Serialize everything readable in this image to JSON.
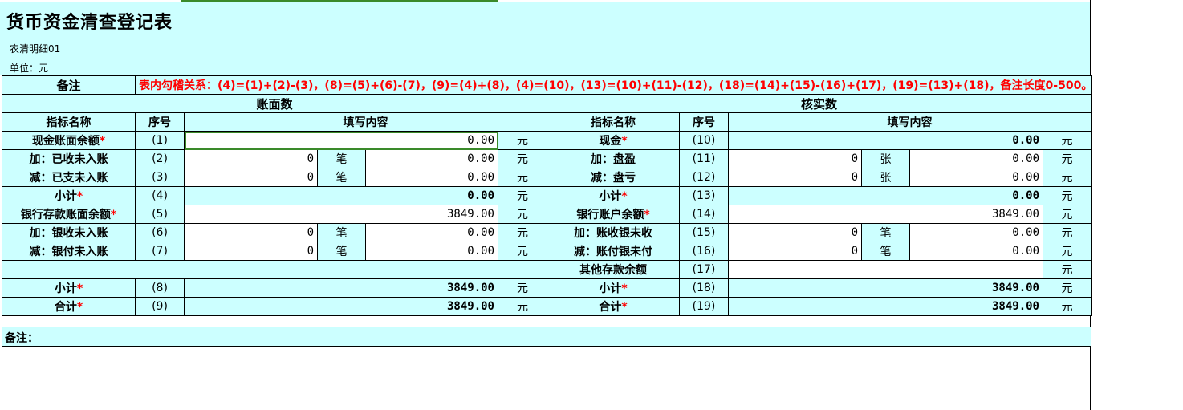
{
  "title": "货币资金清查登记表",
  "subtitle": "农清明细01",
  "unit": "单位：元",
  "note_label": "备注",
  "note_text": "表内勾稽关系：(4)=(1)+(2)-(3)，(8)=(5)+(6)-(7)，(9)=(4)+(8)，(4)=(10)，(13)=(10)+(11)-(12)，(18)=(14)+(15)-(16)+(17)，(19)=(13)+(18)，备注长度0-500。",
  "section_left": "账面数",
  "section_right": "核实数",
  "col_headers": {
    "name": "指标名称",
    "seq": "序号",
    "content": "填写内容"
  },
  "unit_yuan": "元",
  "unit_bi": "笔",
  "unit_zhang": "张",
  "star": "*",
  "left": {
    "r1": {
      "name": "现金账面余额",
      "seq": "(1)",
      "amount": "0.00"
    },
    "r2": {
      "name": "加：已收未入账",
      "seq": "(2)",
      "count": "0",
      "amount": "0.00"
    },
    "r3": {
      "name": "减：已支未入账",
      "seq": "(3)",
      "count": "0",
      "amount": "0.00"
    },
    "r4": {
      "name": "小计",
      "seq": "(4)",
      "amount": "0.00"
    },
    "r5": {
      "name": "银行存款账面余额",
      "seq": "(5)",
      "amount": "3849.00"
    },
    "r6": {
      "name": "加：银收未入账",
      "seq": "(6)",
      "count": "0",
      "amount": "0.00"
    },
    "r7": {
      "name": "减：银付未入账",
      "seq": "(7)",
      "count": "0",
      "amount": "0.00"
    },
    "r8": {
      "name": "小计",
      "seq": "(8)",
      "amount": "3849.00"
    },
    "r9": {
      "name": "合计",
      "seq": "(9)",
      "amount": "3849.00"
    }
  },
  "right": {
    "r10": {
      "name": "现金",
      "seq": "(10)",
      "amount": "0.00"
    },
    "r11": {
      "name": "加：盘盈",
      "seq": "(11)",
      "count": "0",
      "amount": "0.00"
    },
    "r12": {
      "name": "减：盘亏",
      "seq": "(12)",
      "count": "0",
      "amount": "0.00"
    },
    "r13": {
      "name": "小计",
      "seq": "(13)",
      "amount": "0.00"
    },
    "r14": {
      "name": "银行账户余额",
      "seq": "(14)",
      "amount": "3849.00"
    },
    "r15": {
      "name": "加：账收银未收",
      "seq": "(15)",
      "count": "0",
      "amount": "0.00"
    },
    "r16": {
      "name": "减：账付银未付",
      "seq": "(16)",
      "count": "0",
      "amount": "0.00"
    },
    "r17": {
      "name": "其他存款余额",
      "seq": "(17)",
      "amount": ""
    },
    "r18": {
      "name": "小计",
      "seq": "(18)",
      "amount": "3849.00"
    },
    "r19": {
      "name": "合计",
      "seq": "(19)",
      "amount": "3849.00"
    }
  },
  "remark_label": "备注："
}
